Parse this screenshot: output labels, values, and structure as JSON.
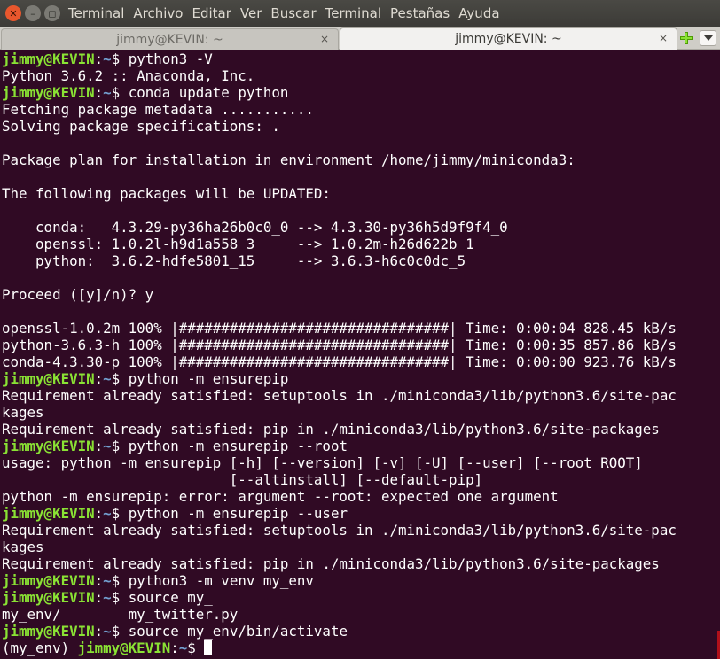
{
  "window": {
    "menu": [
      "Terminal",
      "Archivo",
      "Editar",
      "Ver",
      "Buscar",
      "Terminal",
      "Pestañas",
      "Ayuda"
    ],
    "close_glyph": "✕",
    "min_glyph": "–",
    "max_glyph": "◻"
  },
  "tabs": [
    {
      "label": "jimmy@KEVIN: ~",
      "close": "×",
      "active": false
    },
    {
      "label": "jimmy@KEVIN: ~",
      "close": "×",
      "active": true
    }
  ],
  "colors": {
    "background": "#300a24",
    "prompt_user": "#8ae234",
    "prompt_path": "#729fcf",
    "text": "#ffffff"
  },
  "prompt": {
    "user": "jimmy@KEVIN",
    "sep": ":",
    "path": "~",
    "sym": "$ ",
    "venv_prefix": "(my_env) "
  },
  "lines": [
    {
      "type": "prompt",
      "cmd": "python3 -V"
    },
    {
      "type": "out",
      "text": "Python 3.6.2 :: Anaconda, Inc."
    },
    {
      "type": "prompt",
      "cmd": "conda update python"
    },
    {
      "type": "out",
      "text": "Fetching package metadata ..........."
    },
    {
      "type": "out",
      "text": "Solving package specifications: ."
    },
    {
      "type": "out",
      "text": ""
    },
    {
      "type": "out",
      "text": "Package plan for installation in environment /home/jimmy/miniconda3:"
    },
    {
      "type": "out",
      "text": ""
    },
    {
      "type": "out",
      "text": "The following packages will be UPDATED:"
    },
    {
      "type": "out",
      "text": ""
    },
    {
      "type": "out",
      "text": "    conda:   4.3.29-py36ha26b0c0_0 --> 4.3.30-py36h5d9f9f4_0"
    },
    {
      "type": "out",
      "text": "    openssl: 1.0.2l-h9d1a558_3     --> 1.0.2m-h26d622b_1"
    },
    {
      "type": "out",
      "text": "    python:  3.6.2-hdfe5801_15     --> 3.6.3-h6c0c0dc_5"
    },
    {
      "type": "out",
      "text": ""
    },
    {
      "type": "out",
      "text": "Proceed ([y]/n)? y"
    },
    {
      "type": "out",
      "text": ""
    },
    {
      "type": "out",
      "text": "openssl-1.0.2m 100% |################################| Time: 0:00:04 828.45 kB/s"
    },
    {
      "type": "out",
      "text": "python-3.6.3-h 100% |################################| Time: 0:00:35 857.86 kB/s"
    },
    {
      "type": "out",
      "text": "conda-4.3.30-p 100% |################################| Time: 0:00:00 923.76 kB/s"
    },
    {
      "type": "prompt",
      "cmd": "python -m ensurepip"
    },
    {
      "type": "out",
      "text": "Requirement already satisfied: setuptools in ./miniconda3/lib/python3.6/site-pac"
    },
    {
      "type": "out",
      "text": "kages"
    },
    {
      "type": "out",
      "text": "Requirement already satisfied: pip in ./miniconda3/lib/python3.6/site-packages"
    },
    {
      "type": "prompt",
      "cmd": "python -m ensurepip --root"
    },
    {
      "type": "out",
      "text": "usage: python -m ensurepip [-h] [--version] [-v] [-U] [--user] [--root ROOT]"
    },
    {
      "type": "out",
      "text": "                           [--altinstall] [--default-pip]"
    },
    {
      "type": "out",
      "text": "python -m ensurepip: error: argument --root: expected one argument"
    },
    {
      "type": "prompt",
      "cmd": "python -m ensurepip --user"
    },
    {
      "type": "out",
      "text": "Requirement already satisfied: setuptools in ./miniconda3/lib/python3.6/site-pac"
    },
    {
      "type": "out",
      "text": "kages"
    },
    {
      "type": "out",
      "text": "Requirement already satisfied: pip in ./miniconda3/lib/python3.6/site-packages"
    },
    {
      "type": "prompt",
      "cmd": "python3 -m venv my_env"
    },
    {
      "type": "prompt",
      "cmd": "source my_"
    },
    {
      "type": "out",
      "text": "my_env/        my_twitter.py"
    },
    {
      "type": "prompt",
      "cmd": "source my_env/bin/activate"
    },
    {
      "type": "prompt_venv",
      "cmd": ""
    }
  ]
}
